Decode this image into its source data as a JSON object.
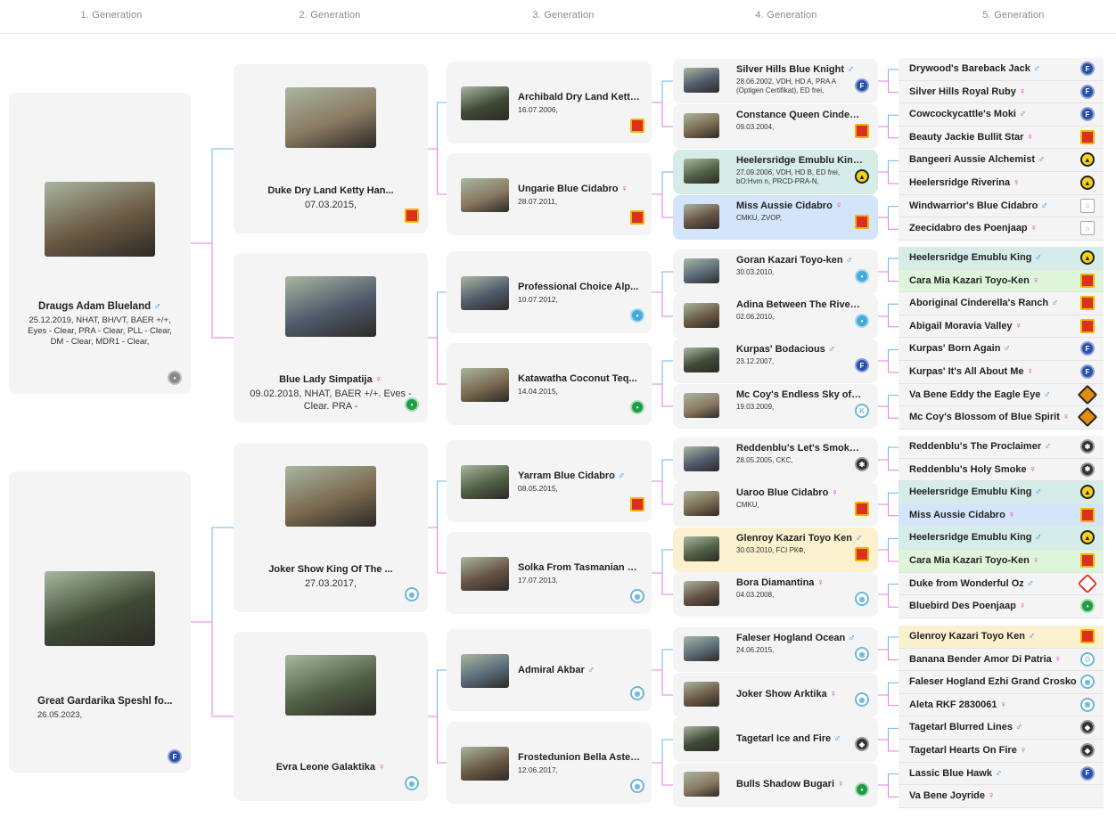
{
  "headers": [
    "1. Generation",
    "2. Generation",
    "3. Generation",
    "4. Generation",
    "5. Generation"
  ],
  "colors": {
    "male": "#2f8fd8",
    "female": "#e236d6",
    "line_male": "#6cb6ea",
    "line_female": "#e47ce4",
    "card_bg": "#f4f4f4"
  },
  "gen1": [
    {
      "name": "Draugs Adam Blueland",
      "sex": "♂",
      "info": "25.12.2019, NHAT, BH/VT, BAER +/+, Eyes - Clear, PRA - Clear, PLL - Clear, DM - Clear, MDR1 - Clear,",
      "badge": "grey-club-icon"
    },
    {
      "name": "Great Gardarika Speshl fo...",
      "sex": "",
      "info": "26.05.2023,",
      "badge": "fci-blue-icon"
    }
  ],
  "gen2": [
    {
      "name": "Duke Dry Land Ketty Han...",
      "sex": "",
      "info": "07.03.2015,",
      "badge": "vdh-icon"
    },
    {
      "name": "Blue Lady Simpatija",
      "sex": "♀",
      "info": "09.02.2018, NHAT, BAER +/+. Eves - Clear. PRA -",
      "badge": "green-club-icon"
    },
    {
      "name": "Joker Show King Of The ...",
      "sex": "",
      "info": "27.03.2017,",
      "badge": "rkf-icon"
    },
    {
      "name": "Evra Leone Galaktika",
      "sex": "♀",
      "info": "",
      "badge": "rkf-icon"
    }
  ],
  "gen3": [
    {
      "name": "Archibald Dry Land Ketty...",
      "sex": "",
      "info": "16.07.2006,",
      "badge": "vdh-icon"
    },
    {
      "name": "Ungarie Blue Cidabro",
      "sex": "♀",
      "info": "28.07.2011,",
      "badge": "vdh-icon"
    },
    {
      "name": "Professional Choice Alp...",
      "sex": "",
      "info": "10.07.2012,",
      "badge": "blue-club-icon"
    },
    {
      "name": "Katawatha Coconut Teq...",
      "sex": "",
      "info": "14.04.2015,",
      "badge": "green-club-icon"
    },
    {
      "name": "Yarram Blue Cidabro",
      "sex": "♂",
      "info": "08.05.2015,",
      "badge": "vdh-icon"
    },
    {
      "name": "Solka From Tasmanian S...",
      "sex": "",
      "info": "17.07.2013,",
      "badge": "rkf-icon"
    },
    {
      "name": "Admiral Akbar",
      "sex": "♂",
      "info": "",
      "badge": "rkf-icon"
    },
    {
      "name": "Frostedunion Bella Aster...",
      "sex": "",
      "info": "12.06.2017,",
      "badge": "rkf-icon"
    }
  ],
  "gen4": [
    {
      "name": "Silver Hills Blue Knight",
      "sex": "♂",
      "info": "28.06.2002, VDH, HD A, PRA A (Optigen Certifikat), ED frei,",
      "badge": "fci-blue-icon",
      "hl": ""
    },
    {
      "name": "Constance Queen Cinderel...",
      "sex": "",
      "info": "09.03.2004,",
      "badge": "vdh-icon",
      "hl": ""
    },
    {
      "name": "Heelersridge Emublu King ...",
      "sex": "",
      "info": "27.09.2006, VDH, HD B, ED frei, bO:Hvm n, PRCD-PRA-N,",
      "badge": "anka-icon",
      "hl": "teal"
    },
    {
      "name": "Miss Aussie Cidabro",
      "sex": "♀",
      "info": "CMKU, ZVOP,",
      "badge": "vdh-icon",
      "hl": "blue"
    },
    {
      "name": "Goran Kazari Toyo-ken",
      "sex": "♂",
      "info": "30.03.2010,",
      "badge": "blue-club-icon",
      "hl": ""
    },
    {
      "name": "Adina Between The Rivers ...",
      "sex": "",
      "info": "02.06.2010,",
      "badge": "blue-club-icon",
      "hl": ""
    },
    {
      "name": "Kurpas' Bodacious",
      "sex": "♂",
      "info": "23.12.2007,",
      "badge": "fci-blue-icon",
      "hl": ""
    },
    {
      "name": "Mc Coy's Endless Sky of Bl...",
      "sex": "",
      "info": "19.03.2009,",
      "badge": "k-icon",
      "hl": ""
    },
    {
      "name": "Reddenblu's Let's Smoke'E...",
      "sex": "",
      "info": "28.05.2005, CKC,",
      "badge": "ckc-icon",
      "hl": ""
    },
    {
      "name": "Uaroo Blue Cidabro",
      "sex": "♀",
      "info": "CMKU,",
      "badge": "vdh-icon",
      "hl": ""
    },
    {
      "name": "Glenroy Kazari Toyo Ken",
      "sex": "♂",
      "info": "30.03.2010, FCI РКФ,",
      "badge": "vdh-icon",
      "hl": "yellow"
    },
    {
      "name": "Bora Diamantina",
      "sex": "♀",
      "info": "04.03.2008,",
      "badge": "rkf-icon",
      "hl": ""
    },
    {
      "name": "Faleser Hogland Ocean",
      "sex": "♂",
      "info": "24.06.2015,",
      "badge": "rkf-icon",
      "hl": ""
    },
    {
      "name": "Joker Show Arktika",
      "sex": "♀",
      "info": "",
      "badge": "rkf-icon",
      "hl": ""
    },
    {
      "name": "Tagetarl Ice and Fire",
      "sex": "♂",
      "info": "",
      "badge": "dog-club-icon",
      "hl": ""
    },
    {
      "name": "Bulls Shadow Bugari",
      "sex": "♀",
      "info": "",
      "badge": "green-club-icon",
      "hl": ""
    }
  ],
  "gen5": [
    {
      "name": "Drywood's Bareback Jack",
      "sex": "♂",
      "badge": "fci-blue-icon",
      "hl": ""
    },
    {
      "name": "Silver Hills Royal Ruby",
      "sex": "♀",
      "badge": "fci-blue-icon",
      "hl": ""
    },
    {
      "name": "Cowcockycattle's Moki",
      "sex": "♂",
      "badge": "fci-blue-icon",
      "hl": ""
    },
    {
      "name": "Beauty Jackie Bullit Star",
      "sex": "♀",
      "badge": "vdh-icon",
      "hl": ""
    },
    {
      "name": "Bangeeri Aussie Alchemist",
      "sex": "♂",
      "badge": "anka-icon",
      "hl": ""
    },
    {
      "name": "Heelersridge Riverina",
      "sex": "♀",
      "badge": "anka-icon",
      "hl": ""
    },
    {
      "name": "Windwarrior's Blue Cidabro",
      "sex": "♂",
      "badge": "house-icon",
      "hl": ""
    },
    {
      "name": "Zeecidabro des Poenjaap",
      "sex": "♀",
      "badge": "house-icon",
      "hl": ""
    },
    {
      "name": "Heelersridge Emublu King",
      "sex": "♂",
      "badge": "anka-icon",
      "hl": "teal"
    },
    {
      "name": "Cara Mia Kazari Toyo-Ken",
      "sex": "♀",
      "badge": "vdh-icon",
      "hl": "green"
    },
    {
      "name": "Aboriginal Cinderella's Ranch",
      "sex": "♂",
      "badge": "vdh-icon",
      "hl": ""
    },
    {
      "name": "Abigail Moravia Valley",
      "sex": "♀",
      "badge": "vdh-icon",
      "hl": ""
    },
    {
      "name": "Kurpas' Born Again",
      "sex": "♂",
      "badge": "fci-blue-icon",
      "hl": ""
    },
    {
      "name": "Kurpas' It's All About Me",
      "sex": "♀",
      "badge": "fci-blue-icon",
      "hl": ""
    },
    {
      "name": "Va Bene Eddy the Eagle Eye",
      "sex": "♂",
      "badge": "orange-club-icon",
      "hl": ""
    },
    {
      "name": "Mc Coy's Blossom of Blue Spirit",
      "sex": "♀",
      "badge": "orange-club-icon",
      "hl": ""
    },
    {
      "name": "Reddenblu's The Proclaimer",
      "sex": "♂",
      "badge": "ckc-icon",
      "hl": ""
    },
    {
      "name": "Reddenblu's Holy Smoke",
      "sex": "♀",
      "badge": "ckc-icon",
      "hl": ""
    },
    {
      "name": "Heelersridge Emublu King",
      "sex": "♂",
      "badge": "anka-icon",
      "hl": "teal"
    },
    {
      "name": "Miss Aussie Cidabro",
      "sex": "♀",
      "badge": "vdh-icon",
      "hl": "blue"
    },
    {
      "name": "Heelersridge Emublu King",
      "sex": "♂",
      "badge": "anka-icon",
      "hl": "teal"
    },
    {
      "name": "Cara Mia Kazari Toyo-Ken",
      "sex": "♀",
      "badge": "vdh-icon",
      "hl": "green"
    },
    {
      "name": "Duke from Wonderful Oz",
      "sex": "♂",
      "badge": "pink-diamond-icon",
      "hl": ""
    },
    {
      "name": "Bluebird Des Poenjaap",
      "sex": "♀",
      "badge": "green-club-icon",
      "hl": ""
    },
    {
      "name": "Glenroy Kazari Toyo Ken",
      "sex": "♂",
      "badge": "vdh-icon",
      "hl": "yellow"
    },
    {
      "name": "Banana Bender Amor Di Patria",
      "sex": "♀",
      "badge": "teal-club-icon",
      "hl": ""
    },
    {
      "name": "Faleser Hogland Ezhi Grand Crosko",
      "sex": "♂",
      "badge": "rkf-icon",
      "hl": ""
    },
    {
      "name": "Aleta RKF 2830061",
      "sex": "♀",
      "badge": "rkf-icon",
      "hl": ""
    },
    {
      "name": "Tagetarl Blurred Lines",
      "sex": "♂",
      "badge": "dog-club-icon",
      "hl": ""
    },
    {
      "name": "Tagetarl Hearts On Fire",
      "sex": "♀",
      "badge": "dog-club-icon",
      "hl": ""
    },
    {
      "name": "Lassic Blue Hawk",
      "sex": "♂",
      "badge": "fci-blue-icon",
      "hl": ""
    },
    {
      "name": "Va Bene Joyride",
      "sex": "♀",
      "badge": "",
      "hl": ""
    }
  ]
}
